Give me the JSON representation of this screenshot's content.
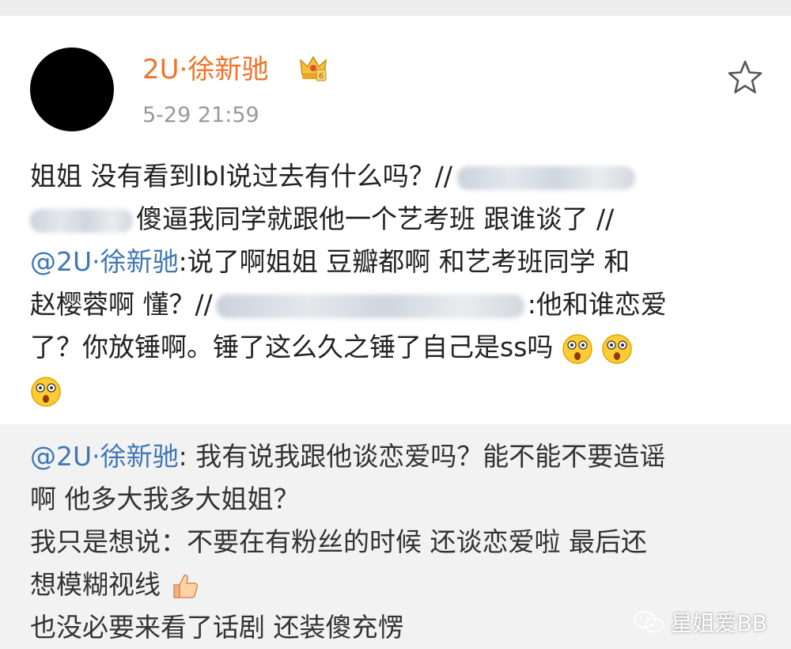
{
  "post": {
    "username": "2U·徐新驰",
    "timestamp": "5-29 21:59",
    "line1": "姐姐 没有看到lbl说过去有什么吗？//",
    "line2": "傻逼我同学就跟他一个艺考班 跟谁谈了 //",
    "line3_mention": "@2U·徐新驰",
    "line3_text": ":说了啊姐姐 豆瓣都啊 和艺考班同学 和",
    "line4a": "赵樱蓉啊 懂？//",
    "line4b": ":他和谁恋爱",
    "line5": "了？你放锤啊。锤了这么久之锤了自己是ss吗"
  },
  "quote": {
    "mention": "@2U·徐新驰",
    "line1": ": 我有说我跟他谈恋爱吗？能不能不要造谣",
    "line2": "啊 他多大我多大姐姐？",
    "line3": "我只是想说：不要在有粉丝的时候 还谈恋爱啦 最后还",
    "line4": "想模糊视线",
    "line5": "也没必要来看了话剧 还装傻充愣"
  },
  "watermark": {
    "text": "星姐爱BB"
  },
  "icons": {
    "vip": "crown-badge-icon",
    "star": "favorite-star-icon",
    "emoji_surprised": "astonished-face-icon",
    "emoji_thumb": "thumbs-up-icon",
    "wechat": "wechat-icon"
  },
  "colors": {
    "username": "#f0732a",
    "mention": "#3f77b5",
    "timestamp": "#999999",
    "quote_bg": "#f2f2f2"
  }
}
